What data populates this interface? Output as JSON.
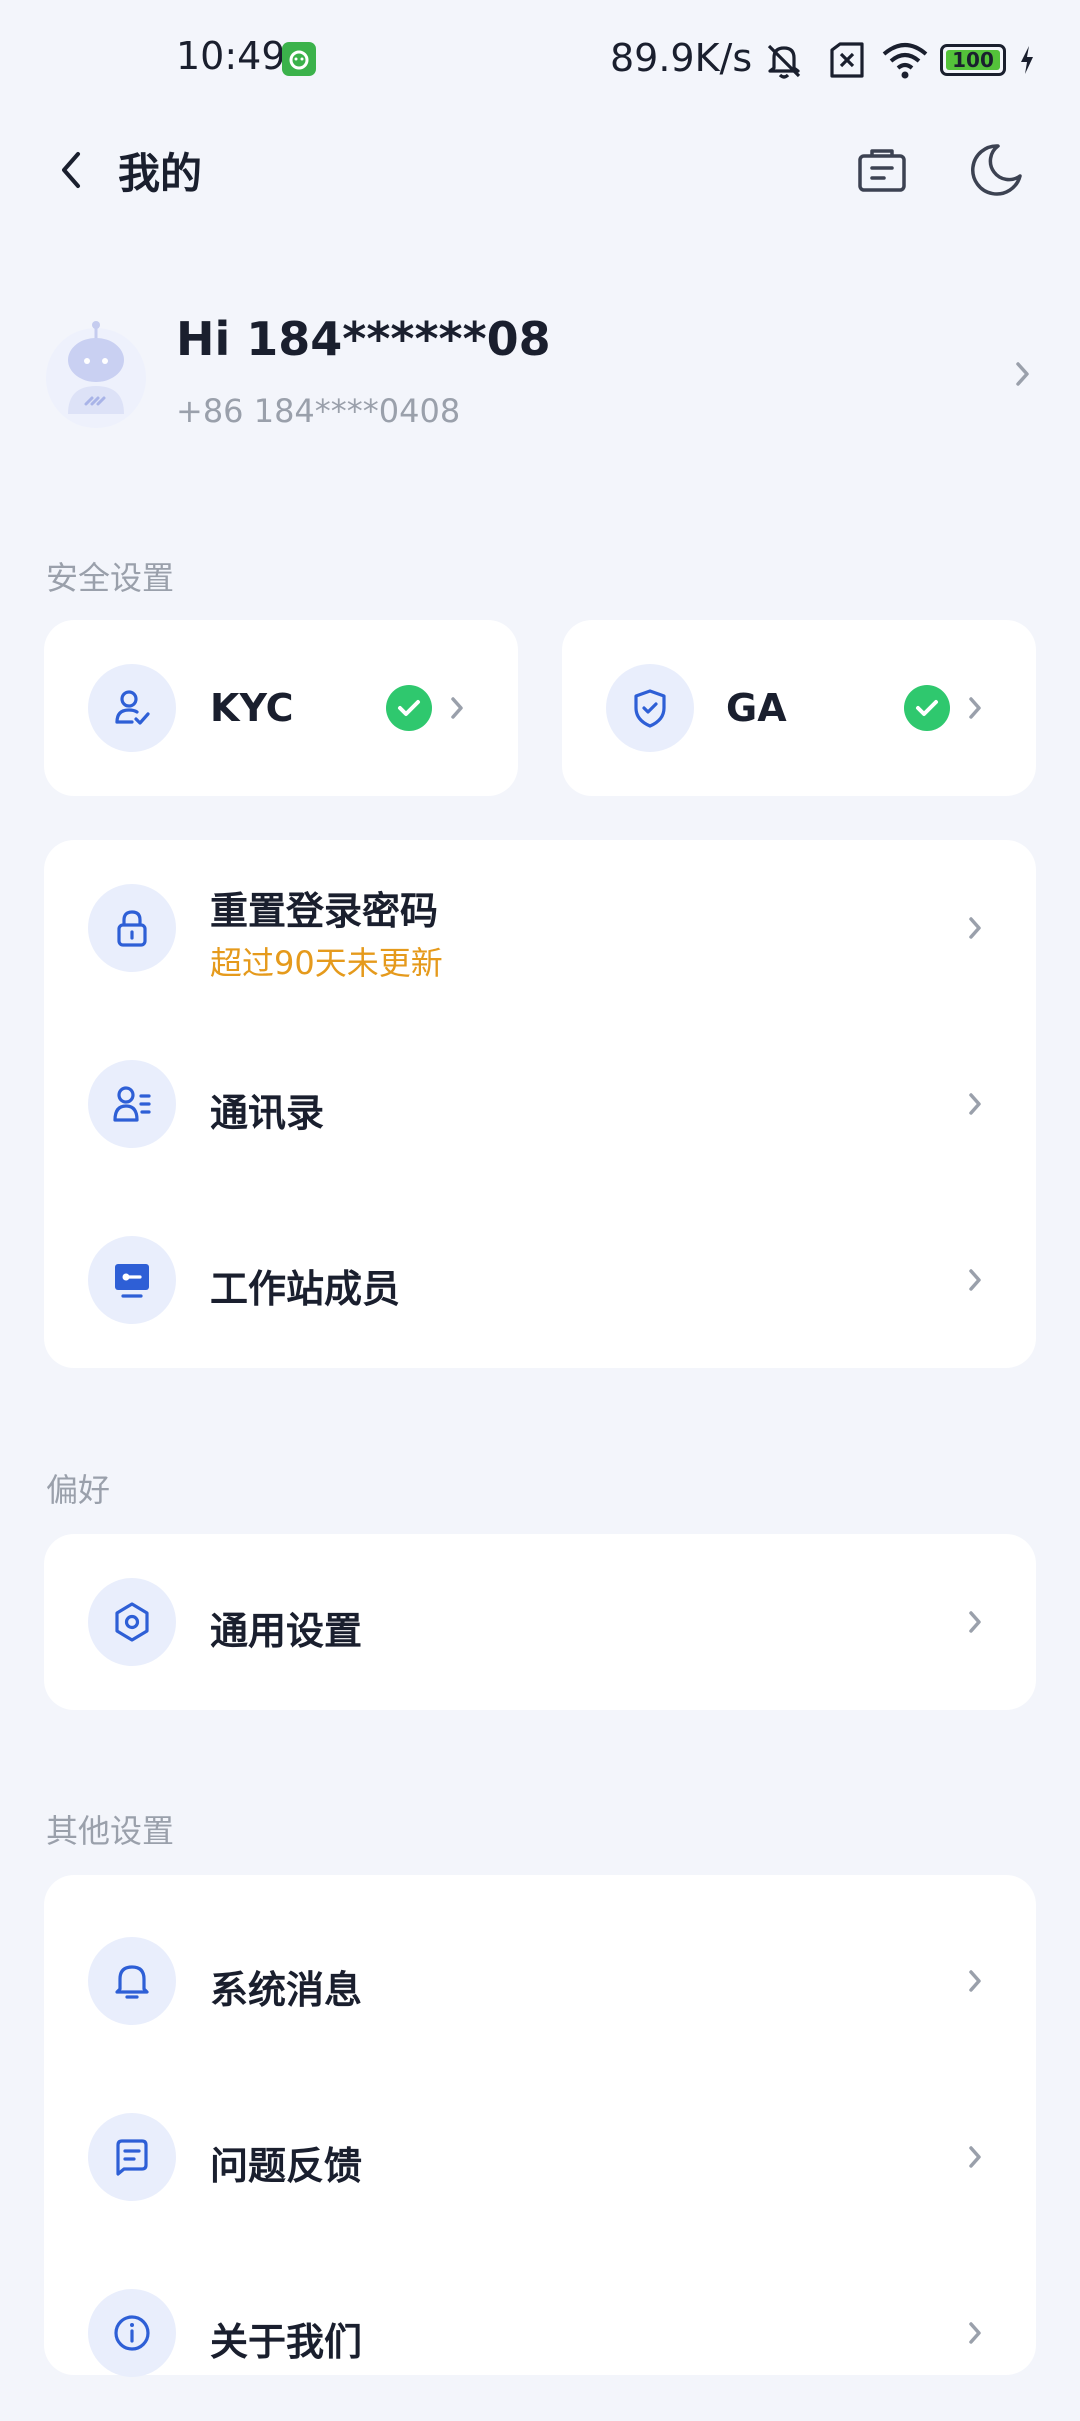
{
  "status_bar": {
    "time": "10:49",
    "net_speed": "89.9K/s",
    "battery": "100"
  },
  "header": {
    "title": "我的"
  },
  "profile": {
    "greeting": "Hi  184******08",
    "phone": "+86 184****0408"
  },
  "sections": {
    "security": "安全设置",
    "preferences": "偏好",
    "other": "其他设置"
  },
  "security_cards": {
    "kyc_label": "KYC",
    "ga_label": "GA"
  },
  "account_items": {
    "reset_password": "重置登录密码",
    "reset_password_sub": "超过90天未更新",
    "contacts": "通讯录",
    "workstation_members": "工作站成员"
  },
  "preference_items": {
    "general_settings": "通用设置"
  },
  "other_items": {
    "system_messages": "系统消息",
    "feedback": "问题反馈",
    "about_us": "关于我们"
  },
  "colors": {
    "accent": "#2e5fd6",
    "icon_bg": "#e9eefc",
    "verified": "#2fc86e",
    "warning": "#e59a1c",
    "muted": "#9aa0ab"
  }
}
